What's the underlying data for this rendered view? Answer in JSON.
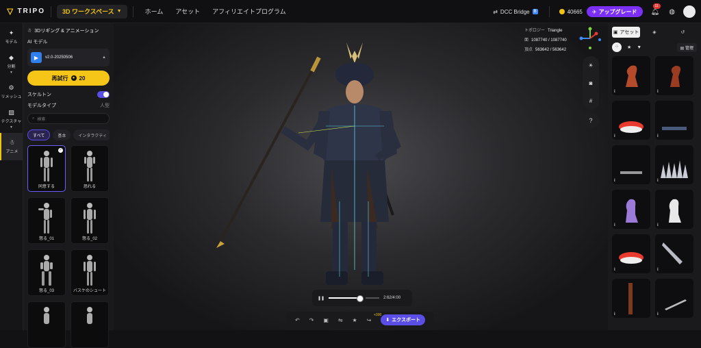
{
  "app": {
    "brand": "TRIPO",
    "workspace": "3D ワークスペース"
  },
  "nav": [
    "ホーム",
    "アセット",
    "アフィリエイトプログラム"
  ],
  "topright": {
    "dcc": "DCC Bridge",
    "dcc_badge": "B",
    "coins": "40665",
    "upgrade": "アップグレード",
    "notif_count": "11"
  },
  "sidebar": [
    {
      "label": "モデル",
      "icon": "sparkle-icon"
    },
    {
      "label": "分割",
      "icon": "split-icon"
    },
    {
      "label": "リメッシュ",
      "icon": "remesh-icon"
    },
    {
      "label": "テクスチャ",
      "icon": "texture-icon"
    },
    {
      "label": "アニメ",
      "icon": "animate-icon"
    }
  ],
  "panel": {
    "title": "3Dリギング & アニメーション",
    "ai_model_label": "AI モデル",
    "model_version": "v2.0-20250506",
    "retry_label": "再試行",
    "retry_cost": "20",
    "skeleton_label": "スケルトン",
    "model_type_label": "モデルタイプ",
    "model_type_value": "人型",
    "search_placeholder": "検索",
    "chips": [
      "すべて",
      "基本",
      "インタラクティ"
    ],
    "animations": [
      "同意する",
      "恐れる",
      "怒る_01",
      "怒る_02",
      "怒る_03",
      "バスケのシュート",
      "",
      ""
    ]
  },
  "viewport": {
    "topology_label": "トポロジー",
    "topology_value": "Triangle",
    "faces_label": "面",
    "faces_value": "1087740 / 1087740",
    "vertices_label": "頂点",
    "vertices_value": "563642 / 563642",
    "time": "2:62/4:00",
    "export_label": "エクスポート",
    "export_bonus": "+300"
  },
  "assets": {
    "tab_label": "アセット",
    "manage_label": "管理",
    "info": "i"
  }
}
